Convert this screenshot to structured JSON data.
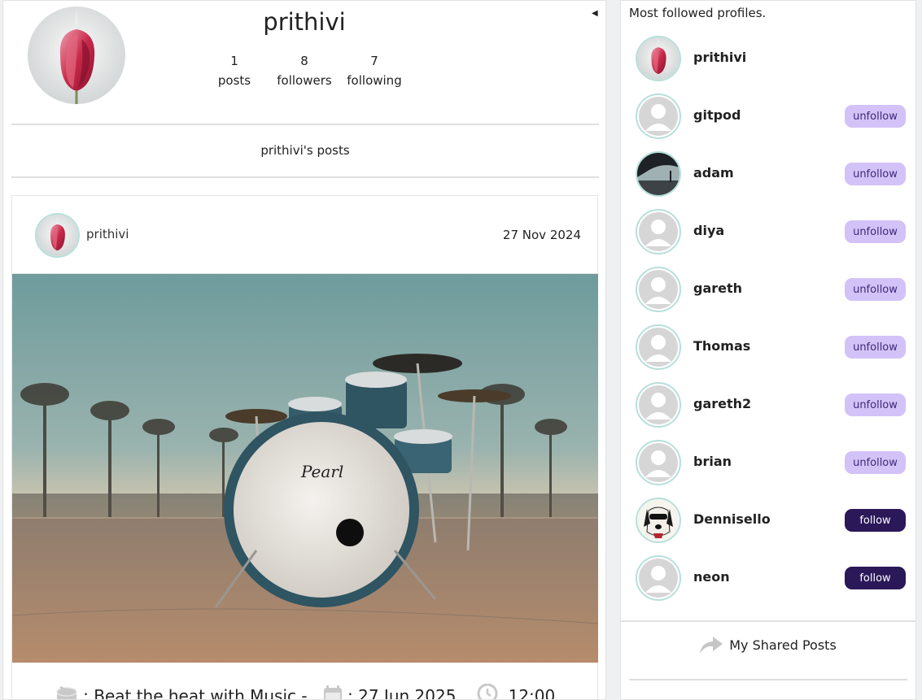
{
  "profile": {
    "name": "prithivi",
    "stats": [
      {
        "value": "1",
        "label": "posts"
      },
      {
        "value": "8",
        "label": "followers"
      },
      {
        "value": "7",
        "label": "following"
      }
    ]
  },
  "posts_section": {
    "heading": "prithivi's posts"
  },
  "post": {
    "author": "prithivi",
    "date": "27 Nov 2024",
    "image_subject": "drum kit on pavement at sunset",
    "event": {
      "title": ": Beat the heat with Music -",
      "date": ": 27 Jun 2025,",
      "time": "12:00"
    }
  },
  "sidebar": {
    "title": "Most followed profiles.",
    "profiles": [
      {
        "name": "prithivi",
        "avatar": "tulip",
        "button": ""
      },
      {
        "name": "gitpod",
        "avatar": "default",
        "button": "unfollow"
      },
      {
        "name": "adam",
        "avatar": "photo-tree",
        "button": "unfollow"
      },
      {
        "name": "diya",
        "avatar": "default",
        "button": "unfollow"
      },
      {
        "name": "gareth",
        "avatar": "default",
        "button": "unfollow"
      },
      {
        "name": "Thomas",
        "avatar": "default",
        "button": "unfollow"
      },
      {
        "name": "gareth2",
        "avatar": "default",
        "button": "unfollow"
      },
      {
        "name": "brian",
        "avatar": "default",
        "button": "unfollow"
      },
      {
        "name": "Dennisello",
        "avatar": "dog",
        "button": "follow"
      },
      {
        "name": "neon",
        "avatar": "default",
        "button": "follow"
      }
    ],
    "shared_posts_label": "My Shared Posts"
  },
  "colors": {
    "unfollow_bg": "#d3c2f7",
    "follow_bg": "#2a1859",
    "avatar_ring": "#b7e0da"
  },
  "icons": [
    "collapse-caret-icon",
    "drum-icon",
    "calendar-icon",
    "clock-icon",
    "share-arrow-icon"
  ]
}
